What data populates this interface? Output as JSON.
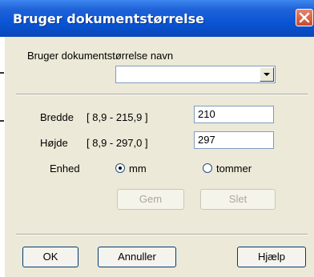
{
  "window": {
    "title": "Bruger dokumentstørrelse"
  },
  "name_section": {
    "label": "Bruger dokumentstørrelse navn",
    "combo_value": ""
  },
  "width": {
    "label": "Bredde",
    "range": "[ 8,9 - 215,9 ]",
    "value": "210"
  },
  "height": {
    "label": "Højde",
    "range": "[ 8,9 - 297,0 ]",
    "value": "297"
  },
  "unit": {
    "label": "Enhed",
    "options": [
      "mm",
      "tommer"
    ],
    "selected": "mm"
  },
  "actions": {
    "save": "Gem",
    "delete": "Slet"
  },
  "footer": {
    "ok": "OK",
    "cancel": "Annuller",
    "help": "Hjælp"
  }
}
